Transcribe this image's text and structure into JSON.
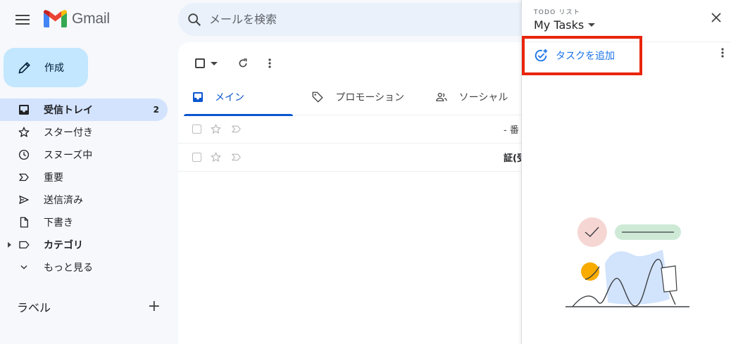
{
  "header": {
    "app_name": "Gmail",
    "search_placeholder": "メールを検索"
  },
  "sidebar": {
    "compose_label": "作成",
    "items": [
      {
        "label": "受信トレイ",
        "count": "2",
        "icon": "inbox-icon"
      },
      {
        "label": "スター付き",
        "icon": "star-icon"
      },
      {
        "label": "スヌーズ中",
        "icon": "clock-icon"
      },
      {
        "label": "重要",
        "icon": "important-icon"
      },
      {
        "label": "送信済み",
        "icon": "send-icon"
      },
      {
        "label": "下書き",
        "icon": "draft-icon"
      },
      {
        "label": "カテゴリ",
        "icon": "label-icon"
      },
      {
        "label": "もっと見る",
        "icon": "chevron-down-icon"
      }
    ],
    "labels_heading": "ラベル"
  },
  "main": {
    "tabs": [
      {
        "label": "メイン",
        "icon": "inbox-icon"
      },
      {
        "label": "プロモーション",
        "icon": "tag-icon"
      },
      {
        "label": "ソーシャル",
        "icon": "people-icon"
      }
    ],
    "rows": [
      {
        "snippet": "- 番"
      },
      {
        "snippet": "証(受"
      }
    ]
  },
  "tasks_panel": {
    "overline": "TODO リスト",
    "title": "My Tasks",
    "add_task_label": "タスクを追加"
  },
  "colors": {
    "accent": "#0b57d0",
    "compose_bg": "#c2e7ff",
    "highlight_box": "#e8250c"
  }
}
